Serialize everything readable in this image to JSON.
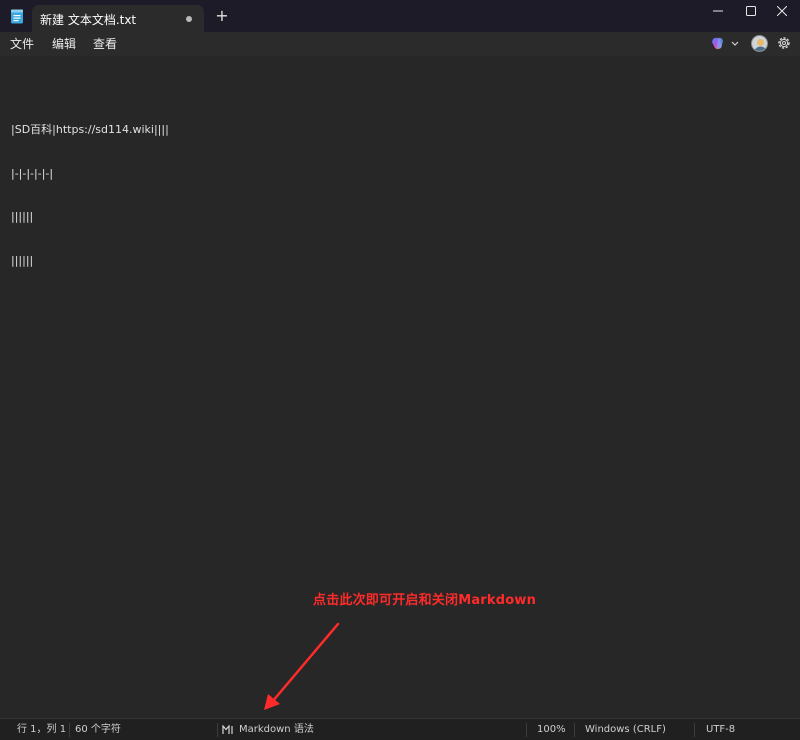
{
  "window": {
    "tab_title": "新建 文本文档.txt",
    "new_tab_label": "+"
  },
  "menu": {
    "items": [
      "文件",
      "编辑",
      "查看"
    ]
  },
  "editor": {
    "lines": [
      "|SD百科|https://sd114.wiki||||",
      "|-|-|-|-|-|",
      "||||||",
      "||||||"
    ]
  },
  "annotation": {
    "text": "点击此次即可开启和关闭Markdown",
    "color": "#ff2a2a"
  },
  "status": {
    "position": "行 1，列 1",
    "char_count": "60 个字符",
    "markdown_label": "Markdown 语法",
    "zoom": "100%",
    "line_ending": "Windows (CRLF)",
    "encoding": "UTF-8"
  },
  "icons": {
    "app": "notepad-icon",
    "tab_modified": "unsaved-dot-icon",
    "minimize": "minimize-icon",
    "maximize": "maximize-icon",
    "close": "close-icon",
    "copilot": "copilot-icon",
    "account": "avatar-icon",
    "settings": "gear-icon",
    "markdown": "markdown-icon"
  },
  "colors": {
    "titlebar": "#1e1b29",
    "editor_bg": "#272727",
    "statusbar": "#202020"
  }
}
